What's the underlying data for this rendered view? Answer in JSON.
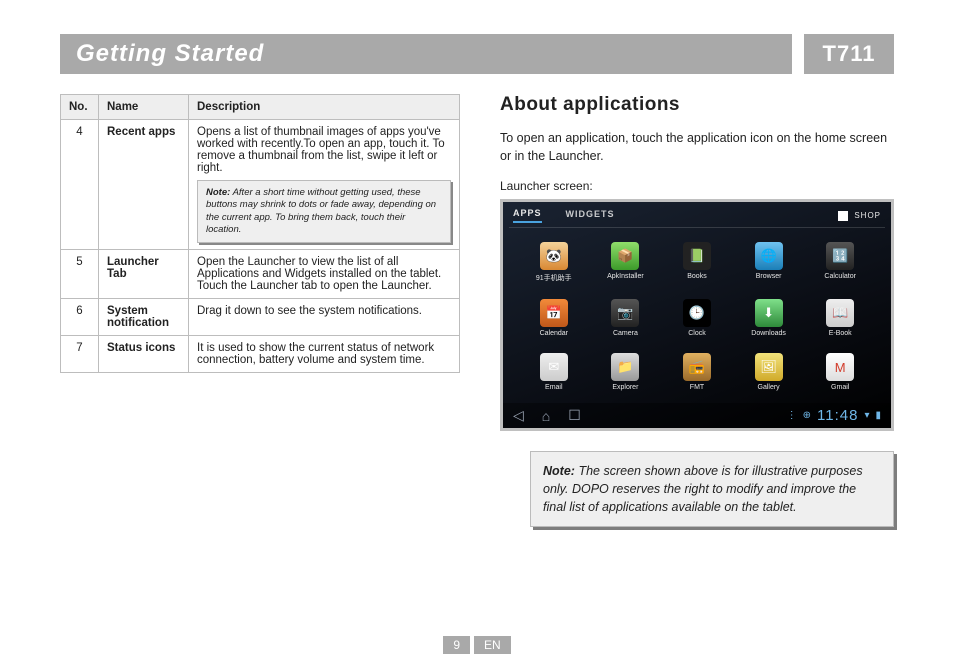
{
  "header": {
    "title": "Getting Started",
    "model": "T711"
  },
  "table": {
    "headers": {
      "no": "No.",
      "name": "Name",
      "desc": "Description"
    },
    "rows": [
      {
        "no": "4",
        "name": "Recent apps",
        "desc": "Opens a list of thumbnail images of apps you've worked with recently.To open an app, touch it. To remove a thumbnail from the list, swipe it left or right.",
        "note": "After a short time without getting used, these buttons may shrink to dots or fade away, depending on the current app. To bring them back, touch their location."
      },
      {
        "no": "5",
        "name": "Launcher Tab",
        "desc": "Open the Launcher to view the list of all Applications and Widgets installed on the tablet. Touch the Launcher tab to open the Launcher."
      },
      {
        "no": "6",
        "name": "System notification",
        "desc": "Drag it down to see the system notifications."
      },
      {
        "no": "7",
        "name": "Status icons",
        "desc": "It is used to show the current status of network connection, battery volume and system time."
      }
    ],
    "note_label": "Note:"
  },
  "right": {
    "heading": "About applications",
    "intro": "To open an application, touch the application icon on the home screen or in the Launcher.",
    "caption": "Launcher screen:"
  },
  "launcher": {
    "tabs": {
      "apps": "APPS",
      "widgets": "WIDGETS",
      "shop": "SHOP"
    },
    "apps": [
      {
        "label": "91手机助手",
        "glyph": "🐼",
        "cls": "c1"
      },
      {
        "label": "ApkInstaller",
        "glyph": "📦",
        "cls": "c2"
      },
      {
        "label": "Books",
        "glyph": "📗",
        "cls": "c3"
      },
      {
        "label": "Browser",
        "glyph": "🌐",
        "cls": "c4"
      },
      {
        "label": "Calculator",
        "glyph": "🔢",
        "cls": "c5"
      },
      {
        "label": "Calendar",
        "glyph": "📅",
        "cls": "c6"
      },
      {
        "label": "Camera",
        "glyph": "📷",
        "cls": "c7"
      },
      {
        "label": "Clock",
        "glyph": "🕒",
        "cls": "c8"
      },
      {
        "label": "Downloads",
        "glyph": "⬇",
        "cls": "c9"
      },
      {
        "label": "E-Book",
        "glyph": "📖",
        "cls": "c10"
      },
      {
        "label": "Email",
        "glyph": "✉",
        "cls": "c11"
      },
      {
        "label": "Explorer",
        "glyph": "📁",
        "cls": "c12"
      },
      {
        "label": "FMT",
        "glyph": "📻",
        "cls": "c13"
      },
      {
        "label": "Gallery",
        "glyph": "🖼",
        "cls": "c14"
      },
      {
        "label": "Gmail",
        "glyph": "M",
        "cls": "c15"
      }
    ],
    "nav": {
      "back": "◁",
      "home": "⌂",
      "recent": "☐"
    },
    "status": {
      "clock": "11:48",
      "wifi": "▾",
      "signal": "▮"
    }
  },
  "big_note": {
    "label": "Note:",
    "text": "The screen shown above is for illustrative purposes only. DOPO reserves the right to modify and improve the final list of applications available on the tablet."
  },
  "footer": {
    "page": "9",
    "lang": "EN"
  }
}
